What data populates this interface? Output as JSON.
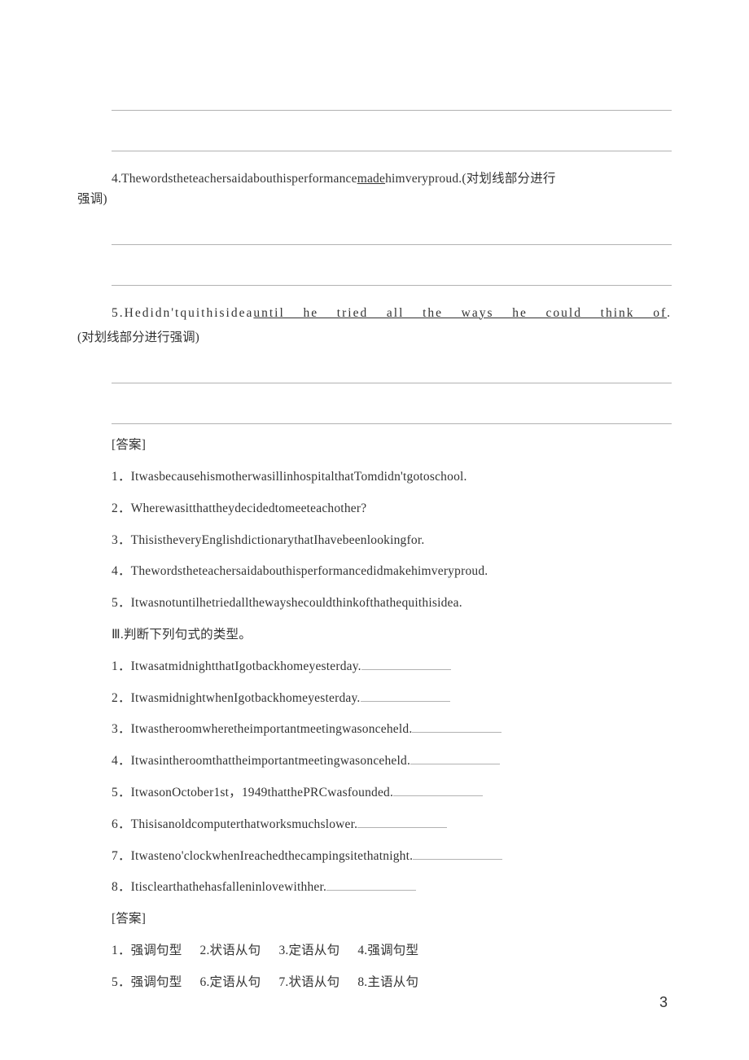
{
  "blanks": {
    "line": ""
  },
  "q4": {
    "pre": "4.Thewordstheteachersaidabouthisperformance",
    "underline": "made",
    "post": "himveryproud.(对划线部分进行",
    "tail": "强调)"
  },
  "q5": {
    "pre": "5.Hedidn'tquithisidea",
    "underline": "until he tried all the ways he could think of",
    "post": ".",
    "tail": "(对划线部分进行强调)"
  },
  "ans_header": "[答案]",
  "answers": [
    "1．ItwasbecausehismotherwasillinhospitalthatTomdidn'tgotoschool.",
    "2．Wherewasitthattheydecidedtomeeteachother?",
    "3．ThisistheveryEnglishdictionarythatIhavebeenlookingfor.",
    "4．Thewordstheteachersaidabouthisperformancedidmakehimveryproud.",
    "5．Itwasnotuntilhetriedallthewayshecouldthinkofthathequithisidea."
  ],
  "part3_header": "Ⅲ.判断下列句式的类型。",
  "part3_items": [
    "1．ItwasatmidnightthatIgotbackhomeyesterday.",
    "2．ItwasmidnightwhenIgotbackhomeyesterday.",
    "3．Itwastheroomwheretheimportantmeetingwasonceheld.",
    "4．Itwasintheroomthattheimportantmeetingwasonceheld.",
    "5．ItwasonOctober1st，1949thatthePRCwasfounded.",
    "6．Thisisanoldcomputerthatworksmuchslower.",
    "7．Itwasteno'clockwhenIreachedthecampingsitethatnight.",
    "8．Itisclearthathehasfalleninlovewithher."
  ],
  "ans2_header": "[答案]",
  "ans2_rows": [
    [
      "1．强调句型",
      "2.状语从句",
      "3.定语从句",
      "4.强调句型"
    ],
    [
      "5．强调句型",
      "6.定语从句",
      "7.状语从句",
      "8.主语从句"
    ]
  ],
  "page_num": "3"
}
